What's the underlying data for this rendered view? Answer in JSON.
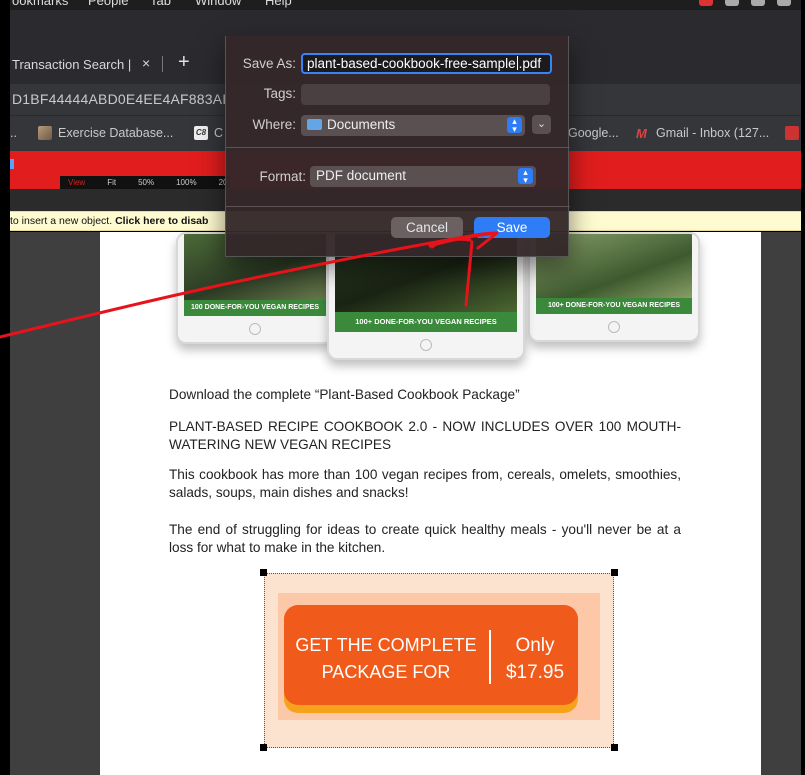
{
  "menubar": {
    "items": [
      "ookmarks",
      "People",
      "Tab",
      "Window",
      "Help"
    ]
  },
  "tab": {
    "title": "Transaction Search |",
    "close": "×",
    "new": "+"
  },
  "address": {
    "text": "D1BF44444ABD0E4EE4AF883AI"
  },
  "bookmarks": {
    "lead": "..",
    "items": [
      {
        "label": "Exercise Database...",
        "icon": "photo-favicon"
      },
      {
        "label": "C",
        "icon": "c-favicon"
      },
      {
        "label": "Google...",
        "icon": ""
      },
      {
        "label": "Gmail - Inbox (127...",
        "icon": "gmail-favicon"
      }
    ]
  },
  "editor_toolbar": {
    "view_label": "View",
    "zoom_options": [
      "Fit",
      "50%",
      "100%",
      "20"
    ]
  },
  "notice": {
    "text": "to insert a new object. ",
    "link": "Click here to disab"
  },
  "tablets": {
    "band_left": "100 DONE-FOR-YOU VEGAN RECIPES",
    "band_center": "100+ DONE-FOR-YOU VEGAN RECIPES",
    "band_right": "100+ DONE-FOR-YOU VEGAN RECIPES"
  },
  "document": {
    "p1": "Download the complete “Plant-Based Cookbook Package”",
    "p2": "PLANT-BASED RECIPE COOKBOOK 2.0 - NOW INCLUDES OVER 100 MOUTH-WATERING NEW VEGAN RECIPES",
    "p3": "This cookbook has more than 100 vegan recipes from, cereals, omelets, smoothies, salads, soups, main dishes and snacks!",
    "p4": "The end of struggling for ideas to create quick healthy meals - you'll never be at a loss for what to make in the kitchen."
  },
  "promo": {
    "left_line1": "GET THE COMPLETE",
    "left_line2": "PACKAGE FOR",
    "right_line1": "Only",
    "right_line2": "$17.95",
    "colors": {
      "button": "#f05a1a",
      "shadow": "#f7a21b",
      "panel": "#fcc8a8"
    }
  },
  "dialog": {
    "save_as_label": "Save As:",
    "filename_before_caret": "plant-based-cookbook-free-sample",
    "filename_after_caret": ".pdf",
    "tags_label": "Tags:",
    "where_label": "Where:",
    "where_value": "Documents",
    "format_label": "Format:",
    "format_value": "PDF document",
    "cancel_label": "Cancel",
    "save_label": "Save",
    "accent_color": "#2f7df6"
  }
}
